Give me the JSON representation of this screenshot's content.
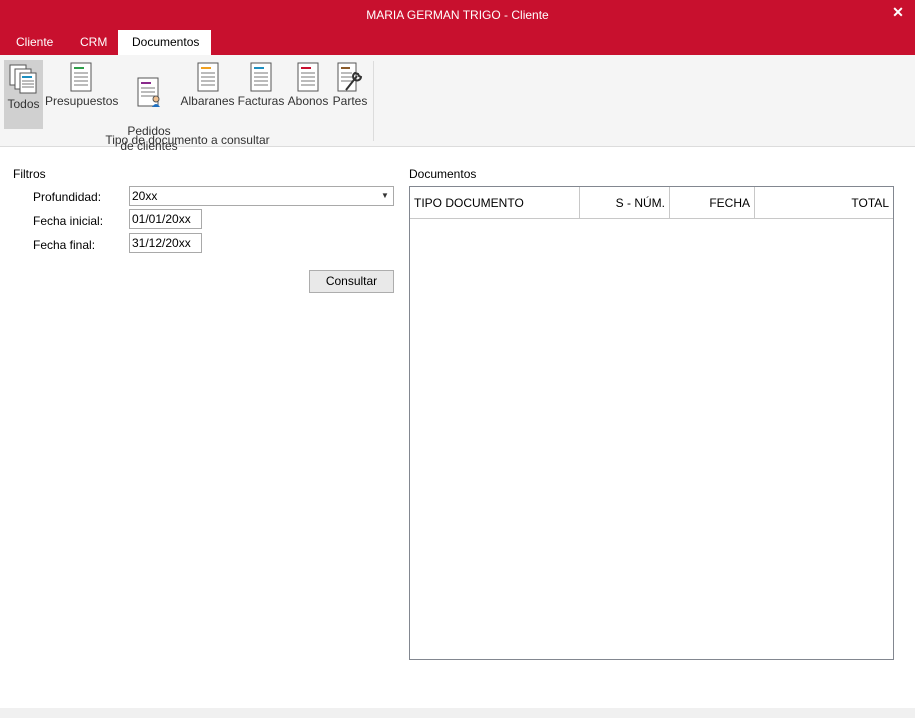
{
  "window": {
    "title": "MARIA GERMAN TRIGO - Cliente",
    "close_glyph": "✕"
  },
  "tabs": [
    {
      "label": "Cliente"
    },
    {
      "label": "CRM"
    },
    {
      "label": "Documentos",
      "active": true
    }
  ],
  "ribbon": {
    "buttons": [
      {
        "label": "Todos",
        "icon": "documents-stack-icon",
        "selected": true
      },
      {
        "label": "Presupuestos",
        "icon": "quote-document-icon",
        "accent": "#2e9e4a"
      },
      {
        "label": "Pedidos\nde clientes",
        "icon": "order-document-icon",
        "accent": "#8a2a8c"
      },
      {
        "label": "Albaranes",
        "icon": "delivery-note-icon",
        "accent": "#f0a020"
      },
      {
        "label": "Facturas",
        "icon": "invoice-document-icon",
        "accent": "#1e8fc0"
      },
      {
        "label": "Abonos",
        "icon": "credit-note-icon",
        "accent": "#c8102e"
      },
      {
        "label": "Partes",
        "icon": "work-order-wrench-icon",
        "accent": "#8a5a2a"
      }
    ],
    "group_label": "Tipo de documento a consultar"
  },
  "filters": {
    "title": "Filtros",
    "profundidad_label": "Profundidad:",
    "profundidad_value": "20xx",
    "fecha_inicial_label": "Fecha inicial:",
    "fecha_inicial_value": "01/01/20xx",
    "fecha_final_label": "Fecha final:",
    "fecha_final_value": "31/12/20xx",
    "consultar_label": "Consultar"
  },
  "documents": {
    "title": "Documentos",
    "columns": [
      "TIPO DOCUMENTO",
      "S - NÚM.",
      "FECHA",
      "TOTAL"
    ],
    "rows": []
  },
  "colors": {
    "brand": "#c8102e",
    "ribbon_bg": "#f5f5f5"
  }
}
